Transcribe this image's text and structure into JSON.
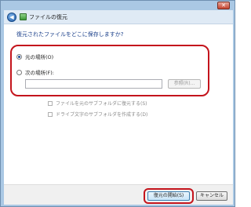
{
  "window": {
    "title": "ファイルの復元",
    "close_glyph": "✕",
    "back_glyph": "◀"
  },
  "content": {
    "question": "復元されたファイルをどこに保存しますか?",
    "options": {
      "original_location": {
        "label": "元の場所(O)",
        "selected": true
      },
      "following_location": {
        "label": "次の場所(F):",
        "selected": false
      }
    },
    "path_input": {
      "value": "",
      "placeholder": ""
    },
    "browse_button_label": "参照(R)...",
    "checkboxes": [
      {
        "label": "ファイルを元のサブフォルダに復元する(S)",
        "checked": false
      },
      {
        "label": "ドライブ文字のサブフォルダを作成する(D)",
        "checked": false
      }
    ]
  },
  "footer": {
    "start_restore_label": "復元の開始(S)",
    "cancel_label": "キャンセル"
  },
  "colors": {
    "highlight": "#c4141c",
    "link_text": "#1a3f8a",
    "title_bar": "#dfeaf5"
  }
}
